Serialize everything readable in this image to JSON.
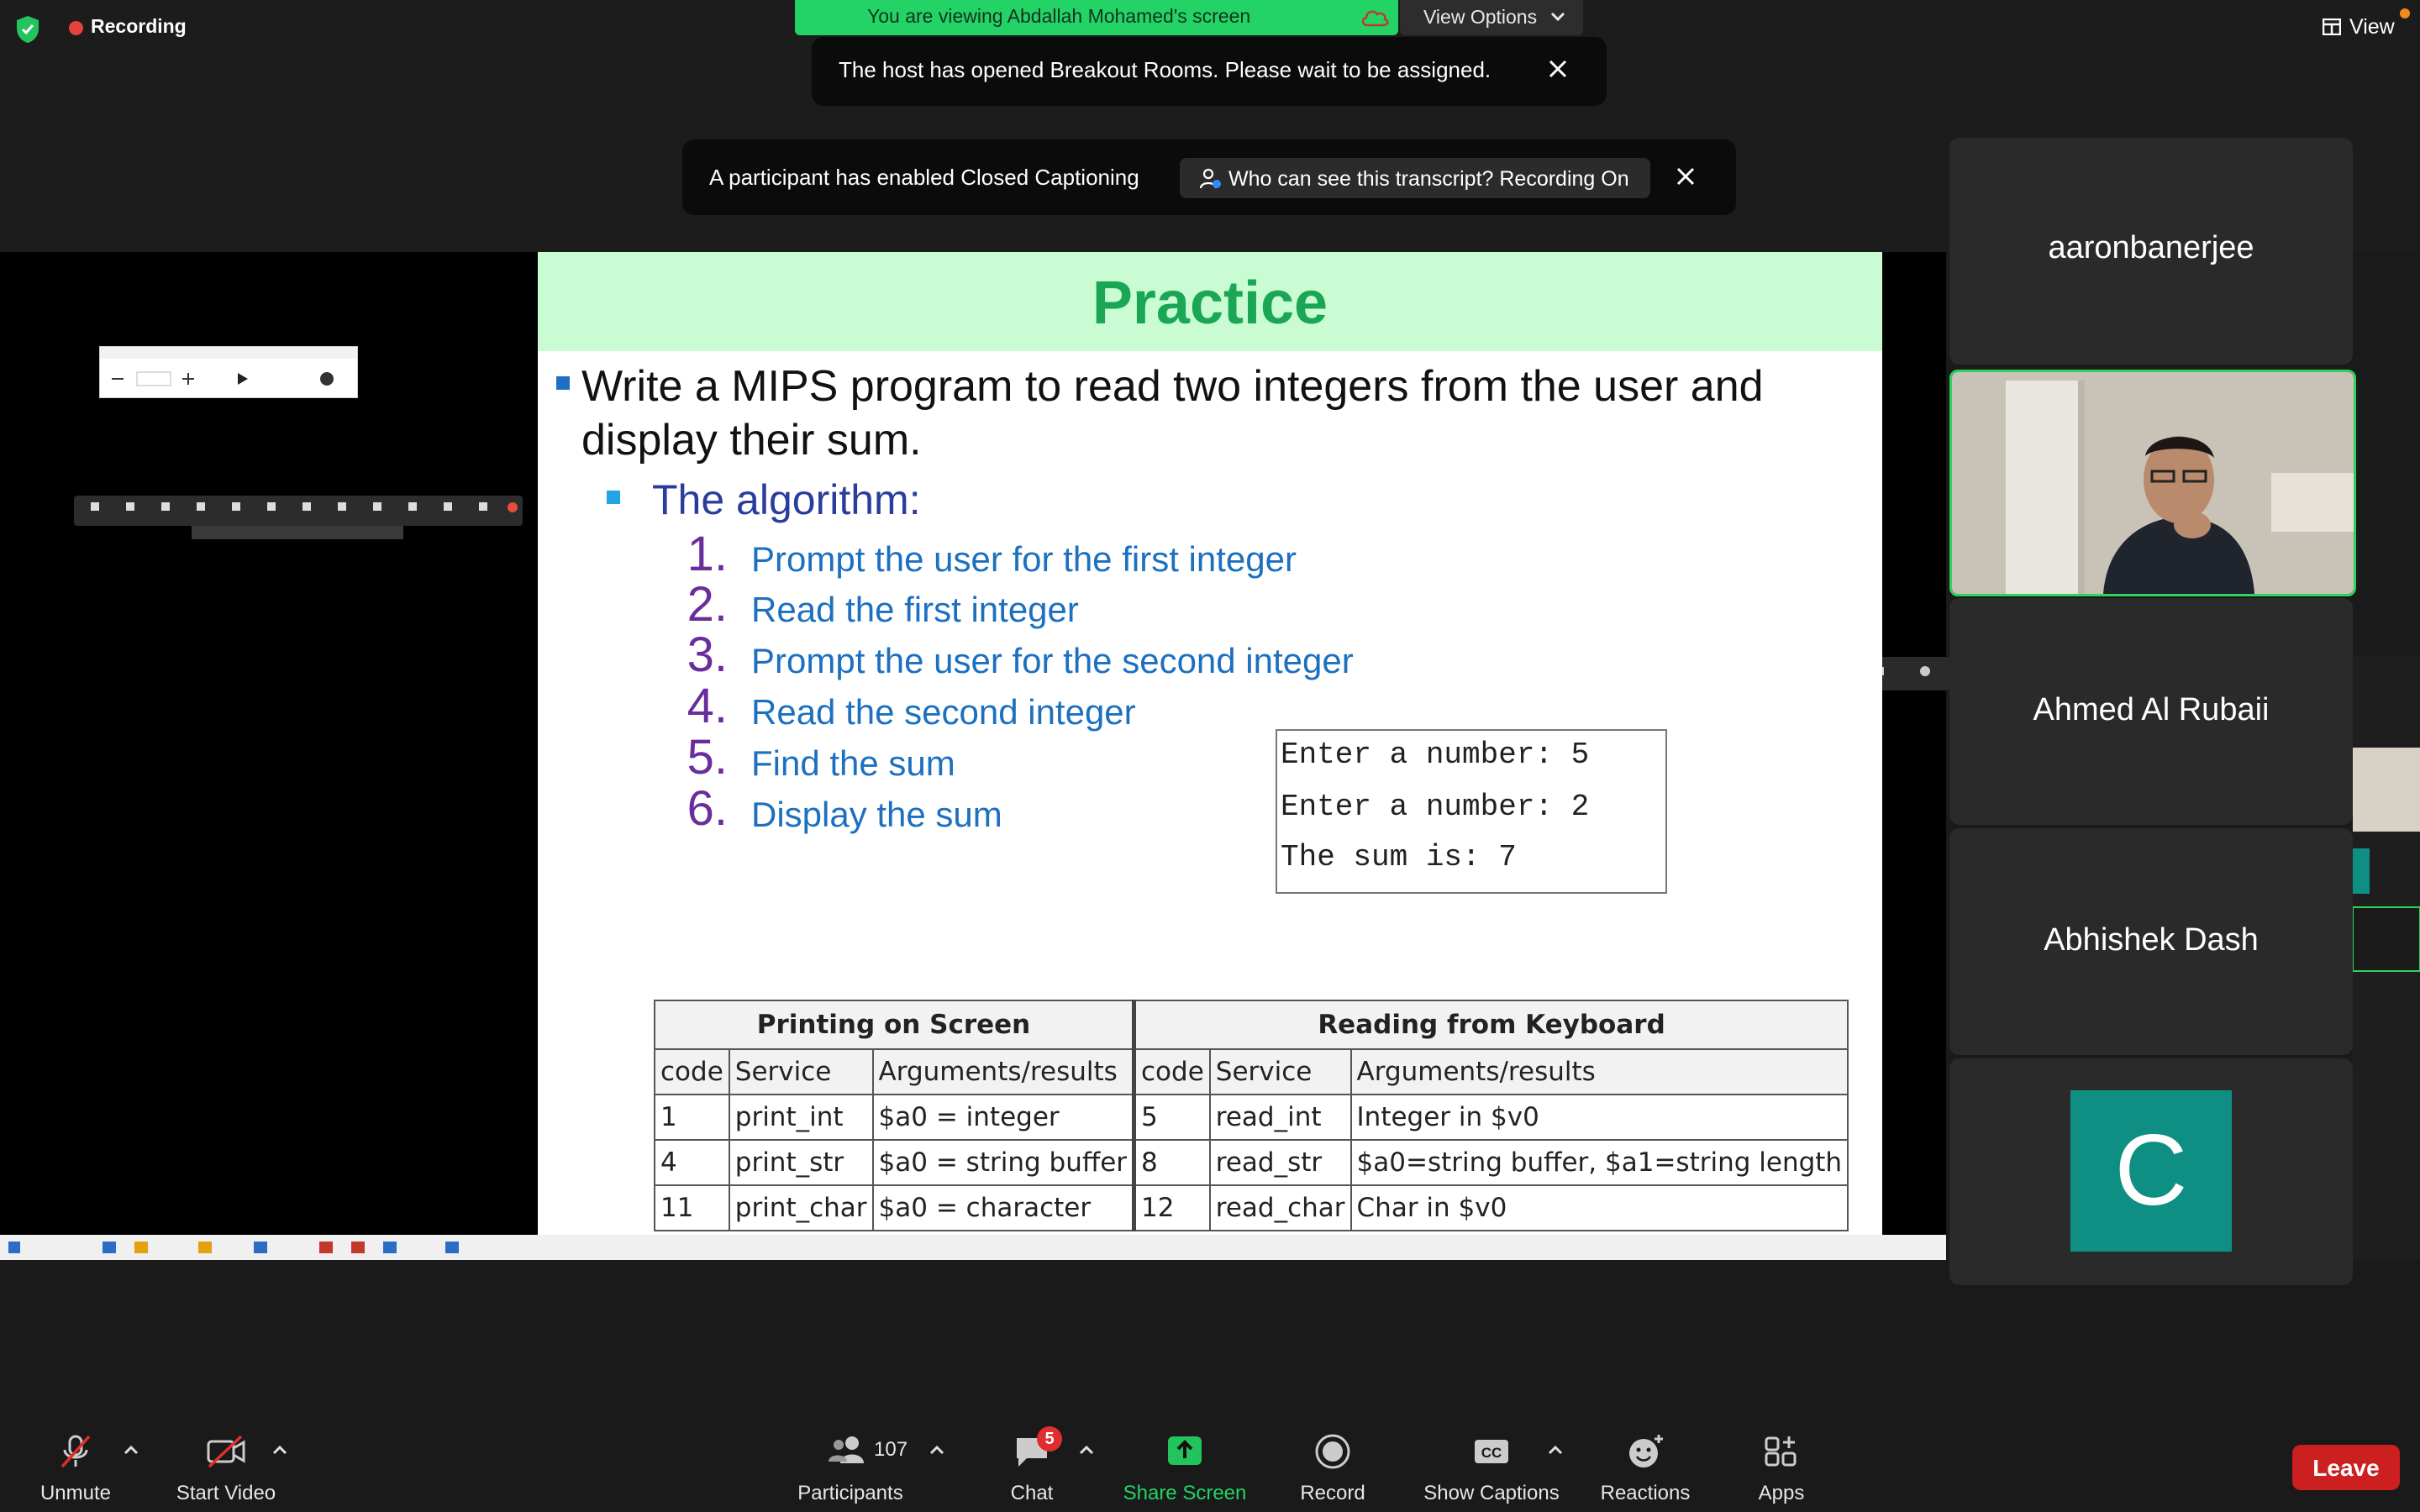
{
  "top": {
    "recording_label": "Recording",
    "viewing_banner": "You are viewing Abdallah Mohamed's screen",
    "view_options_label": "View Options",
    "view_label": "View"
  },
  "notifications": {
    "breakout": "The host has opened Breakout Rooms. Please wait to be assigned.",
    "captioning": "A participant has enabled Closed Captioning",
    "transcript_button": "Who can see this transcript? Recording On"
  },
  "slide": {
    "title": "Practice",
    "bullet1": "Write a MIPS program to read two integers from the user and display their sum.",
    "bullet2": "The algorithm:",
    "steps": [
      {
        "num": "1.",
        "text": "Prompt the user for the first integer"
      },
      {
        "num": "2.",
        "text": "Read the first integer"
      },
      {
        "num": "3.",
        "text": "Prompt the user for the second integer"
      },
      {
        "num": "4.",
        "text": "Read the second integer"
      },
      {
        "num": "5.",
        "text": "Find the sum"
      },
      {
        "num": "6.",
        "text": "Display the sum"
      }
    ],
    "console": [
      "Enter a number: 5",
      "Enter a number: 2",
      "The sum is: 7"
    ],
    "table": {
      "group_headers": [
        "Printing on Screen",
        "Reading from Keyboard"
      ],
      "col_headers": [
        "code",
        "Service",
        "Arguments/results",
        "code",
        "Service",
        "Arguments/results"
      ],
      "rows": [
        [
          "1",
          "print_int",
          "$a0 = integer",
          "5",
          "read_int",
          "Integer in $v0"
        ],
        [
          "4",
          "print_str",
          "$a0 = string buffer",
          "8",
          "read_str",
          "$a0=string buffer, $a1=string length"
        ],
        [
          "11",
          "print_char",
          "$a0 = character",
          "12",
          "read_char",
          "Char in $v0"
        ]
      ]
    }
  },
  "gallery": {
    "tile1_name": "aaronbanerjee",
    "tile3_name": "Ahmed Al Rubaii",
    "tile4_name": "Abhishek Dash",
    "tile5_initial": "C"
  },
  "controls": {
    "unmute": "Unmute",
    "start_video": "Start Video",
    "participants": "Participants",
    "participants_count": "107",
    "chat": "Chat",
    "chat_badge": "5",
    "share_screen": "Share Screen",
    "record": "Record",
    "show_captions": "Show Captions",
    "reactions": "Reactions",
    "apps": "Apps",
    "leave": "Leave"
  },
  "colors": {
    "share_green": "#23d366",
    "slide_title_green": "#1aa654",
    "leave_red": "#cc1f1f",
    "active_speaker_border": "#2fd25a"
  }
}
